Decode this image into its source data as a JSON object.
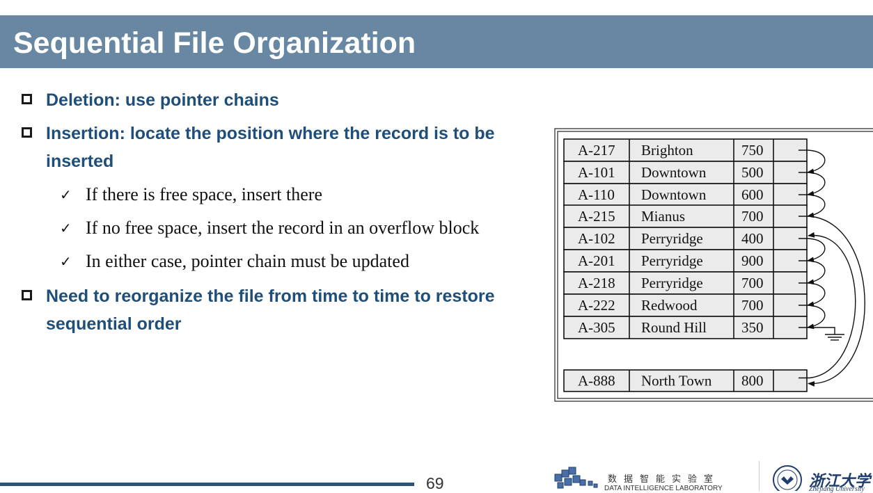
{
  "slide": {
    "title": "Sequential File Organization",
    "page_number": "69"
  },
  "bullets": [
    {
      "text": "Deletion: use pointer chains"
    },
    {
      "text": "Insertion: locate the position where the record is to be inserted"
    },
    {
      "text": "Need to reorganize the file from time to time to restore sequential order"
    }
  ],
  "sub_bullets": [
    {
      "text": "If there is free space, insert there"
    },
    {
      "text": "If no free space, insert the record in an overflow block"
    },
    {
      "text": "In either case, pointer chain must be updated"
    }
  ],
  "table": {
    "main_rows": [
      {
        "account": "A-217",
        "branch": "Brighton",
        "balance": "750"
      },
      {
        "account": "A-101",
        "branch": "Downtown",
        "balance": "500"
      },
      {
        "account": "A-110",
        "branch": "Downtown",
        "balance": "600"
      },
      {
        "account": "A-215",
        "branch": "Mianus",
        "balance": "700"
      },
      {
        "account": "A-102",
        "branch": "Perryridge",
        "balance": "400"
      },
      {
        "account": "A-201",
        "branch": "Perryridge",
        "balance": "900"
      },
      {
        "account": "A-218",
        "branch": "Perryridge",
        "balance": "700"
      },
      {
        "account": "A-222",
        "branch": "Redwood",
        "balance": "700"
      },
      {
        "account": "A-305",
        "branch": "Round Hill",
        "balance": "350"
      }
    ],
    "overflow_row": {
      "account": "A-888",
      "branch": "North Town",
      "balance": "800"
    }
  },
  "footer": {
    "lab_name_cn": "数据智能实验室",
    "lab_name_en": "DATA INTELLIGENCE LABORATORY",
    "university_cn": "浙江大学",
    "university_en": "Zhejiang University"
  }
}
